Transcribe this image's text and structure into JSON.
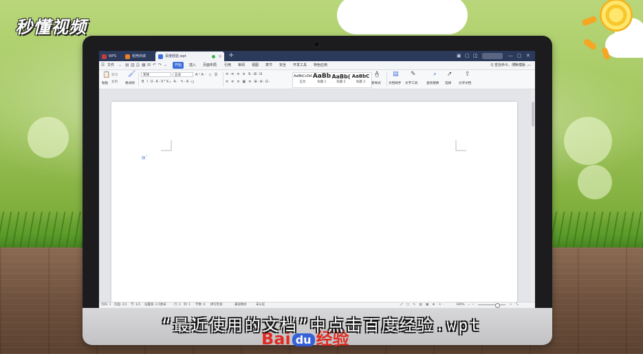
{
  "overlay": {
    "logo": "秒懂视频",
    "subtitle": "“最近使用的文档”中点击百度经验.wpt",
    "watermark": {
      "left": "Bai",
      "paw": "du",
      "right": "经验"
    }
  },
  "wps": {
    "tabs": [
      {
        "label": "WPS"
      },
      {
        "label": "稻壳商城"
      },
      {
        "label": "百度经验.wpt",
        "active": true
      }
    ],
    "tab_add": "+",
    "menu": {
      "file": "文件",
      "items": [
        "开始",
        "插入",
        "页面布局",
        "引用",
        "审阅",
        "视图",
        "章节",
        "安全",
        "开发工具",
        "特色应用"
      ],
      "active_index": 0,
      "search": "Q 查找命令、搜索模板"
    },
    "ribbon": {
      "paste": "粘贴",
      "cut": "剪切",
      "copy": "复制",
      "format_painter": "格式刷",
      "font_name": "宋体",
      "font_size": "五号",
      "styles": [
        {
          "sample": "AaBbCcDd",
          "name": "正文"
        },
        {
          "sample": "AaBb",
          "name": "标题 1"
        },
        {
          "sample": "AaBb(",
          "name": "标题 2"
        },
        {
          "sample": "AaBbC",
          "name": "标题 3"
        }
      ],
      "new_style": "新样式",
      "doc_assistant": "文档助手",
      "text_tools": "文字工具",
      "find_replace": "查找替换",
      "select": "选择",
      "share_doc": "分享文档"
    },
    "status": {
      "page_no": "页码: 1",
      "pages": "页面: 1/1",
      "section": "节: 1/1",
      "setting": "设置值: 2.5厘米",
      "row": "行: 1",
      "col": "列: 1",
      "word_count": "字数: 0",
      "spell_check": "拼写检查",
      "compat_mode": "兼容模式",
      "uncertified": "未认证",
      "zoom": "180%"
    }
  }
}
